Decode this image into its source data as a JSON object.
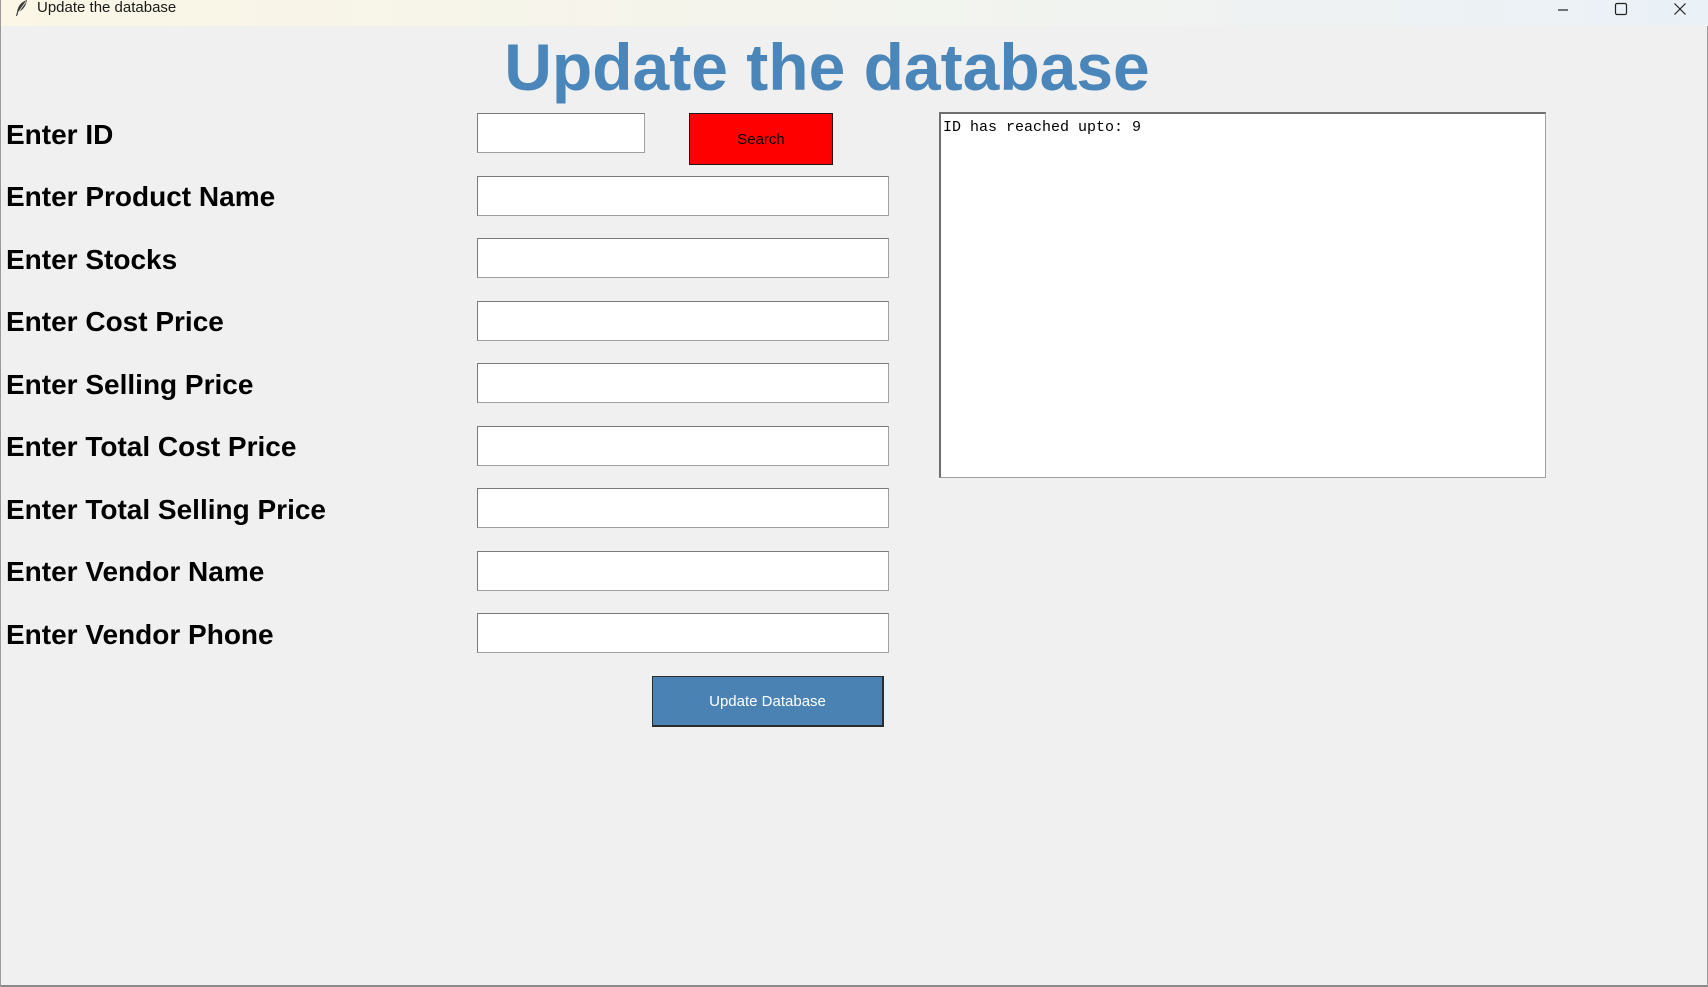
{
  "window": {
    "title": "Update the database"
  },
  "header": {
    "title": "Update the database",
    "title_color": "#4a86b9"
  },
  "form": {
    "fields": [
      {
        "label": "Enter ID",
        "value": ""
      },
      {
        "label": "Enter Product Name",
        "value": ""
      },
      {
        "label": "Enter Stocks",
        "value": ""
      },
      {
        "label": "Enter Cost Price",
        "value": ""
      },
      {
        "label": "Enter Selling Price",
        "value": ""
      },
      {
        "label": "Enter Total Cost Price",
        "value": ""
      },
      {
        "label": "Enter Total Selling Price",
        "value": ""
      },
      {
        "label": "Enter Vendor Name",
        "value": ""
      },
      {
        "label": "Enter Vendor Phone",
        "value": ""
      }
    ],
    "search_label": "Search",
    "search_color": "#ff0000",
    "update_label": "Update Database",
    "update_color": "#4a82b4"
  },
  "output": {
    "text": "ID has reached upto: 9"
  },
  "icons": {
    "app": "feather-icon",
    "minimize": "minimize-icon",
    "maximize": "maximize-icon",
    "close": "close-icon"
  }
}
